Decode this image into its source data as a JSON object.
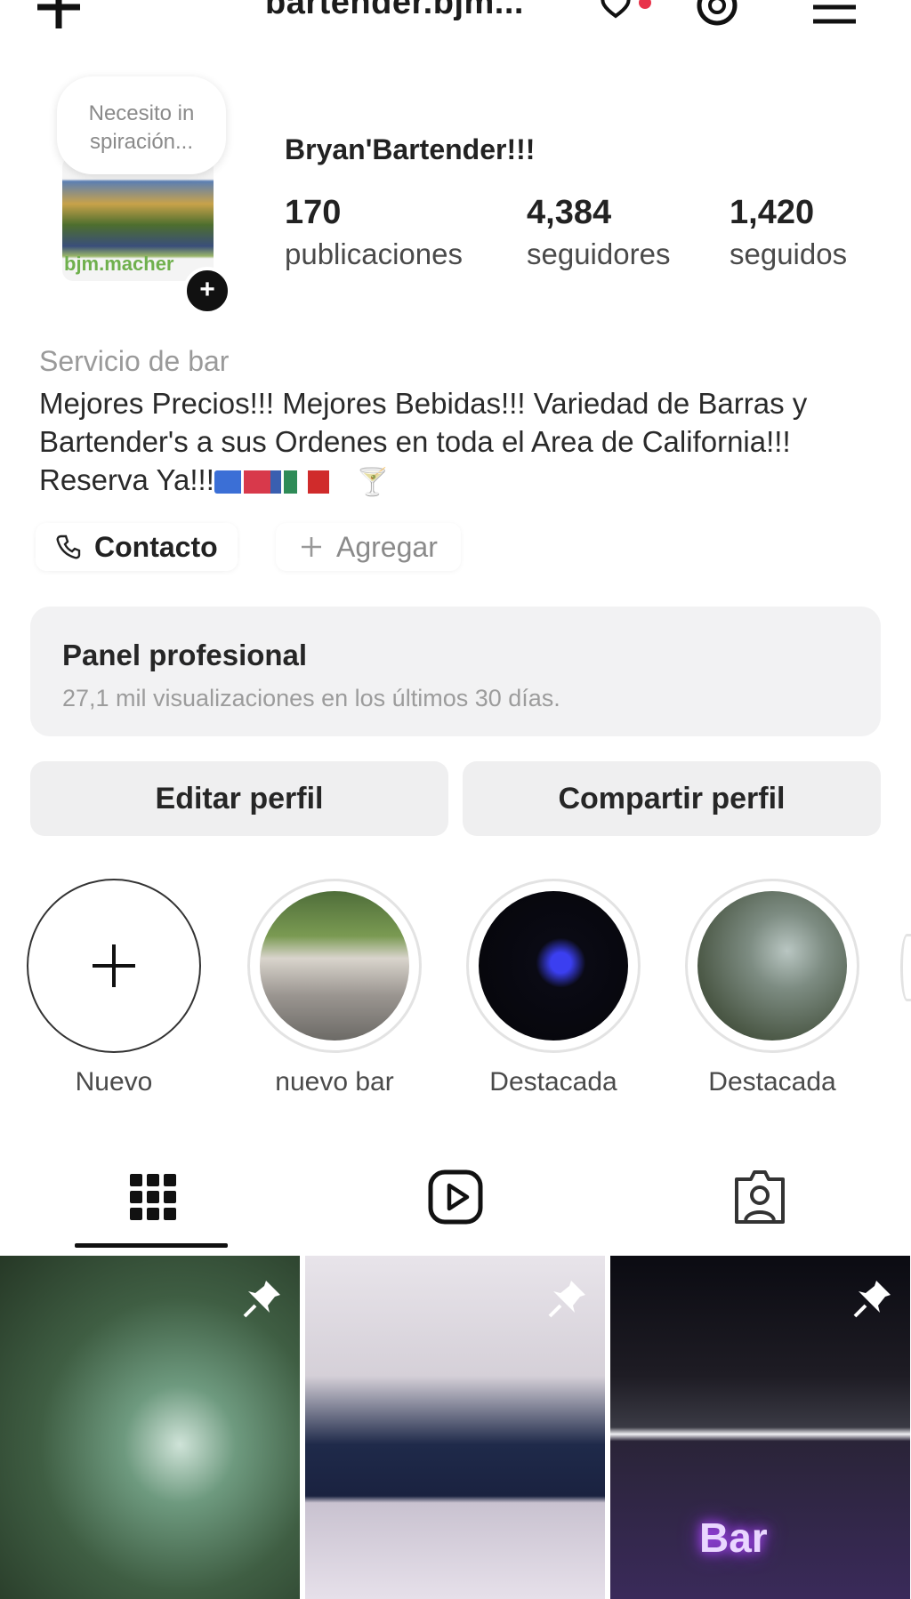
{
  "header": {
    "username": "bartender.bjm..."
  },
  "profile": {
    "name": "Bryan'Bartender!!!",
    "note": "Necesito in spiración...",
    "avatar_caption": "bjm.macher",
    "stats": [
      {
        "value": "170",
        "label": "publicaciones"
      },
      {
        "value": "4,384",
        "label": "seguidores"
      },
      {
        "value": "1,420",
        "label": "seguidos"
      }
    ],
    "category": "Servicio de bar",
    "bio": "Mejores Precios!!! Mejores Bebidas!!! Variedad de Barras y Bartender's a sus Ordenes en toda el Area de California!!! Reserva Ya!!!"
  },
  "actions": {
    "contact": "Contacto",
    "add": "Agregar"
  },
  "pro_panel": {
    "title": "Panel profesional",
    "subtitle": "27,1 mil visualizaciones en los últimos 30 días."
  },
  "buttons": {
    "edit": "Editar perfil",
    "share": "Compartir perfil"
  },
  "highlights": [
    {
      "label": "Nuevo"
    },
    {
      "label": "nuevo bar"
    },
    {
      "label": "Destacada"
    },
    {
      "label": "Destacada"
    }
  ],
  "grid": {
    "neon_text": "Bar"
  },
  "colors": {
    "notification_dot": "#e8334a",
    "accent_green": "#6fb04d"
  }
}
